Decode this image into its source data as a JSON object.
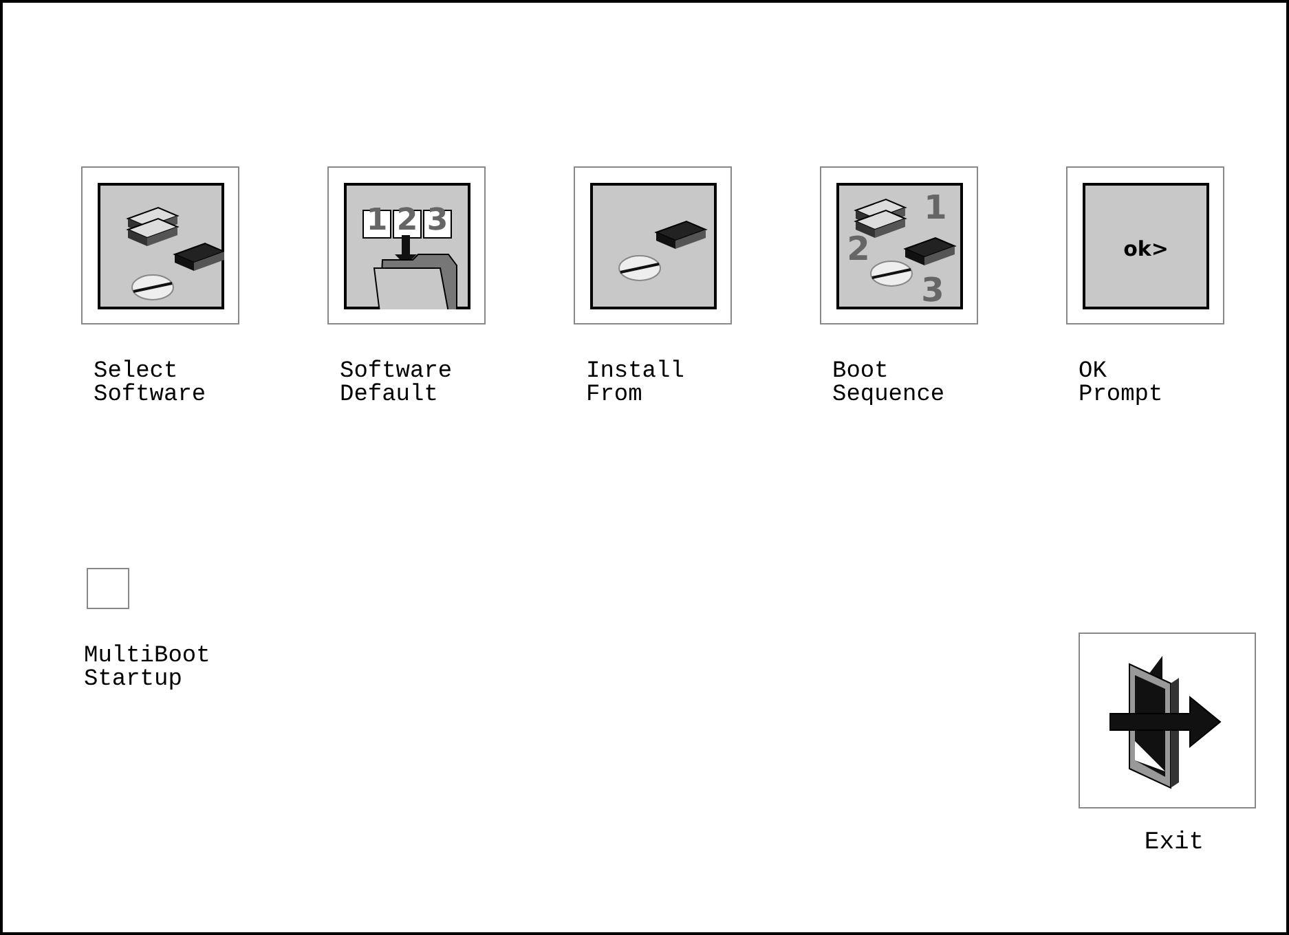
{
  "menu_items": [
    {
      "kind": "select-software",
      "label": "Select\nSoftware"
    },
    {
      "kind": "software-default",
      "label": "Software\nDefault",
      "icon_text": [
        "1",
        "2",
        "3"
      ]
    },
    {
      "kind": "install-from",
      "label": "Install\nFrom"
    },
    {
      "kind": "boot-sequence",
      "label": "Boot\nSequence",
      "icon_text": [
        "1",
        "2",
        "3"
      ]
    },
    {
      "kind": "ok-prompt",
      "label": "OK\nPrompt",
      "icon_text": [
        "ok>"
      ]
    }
  ],
  "multiboot": {
    "label": "MultiBoot\nStartup",
    "checked": false
  },
  "exit": {
    "label": "Exit"
  }
}
